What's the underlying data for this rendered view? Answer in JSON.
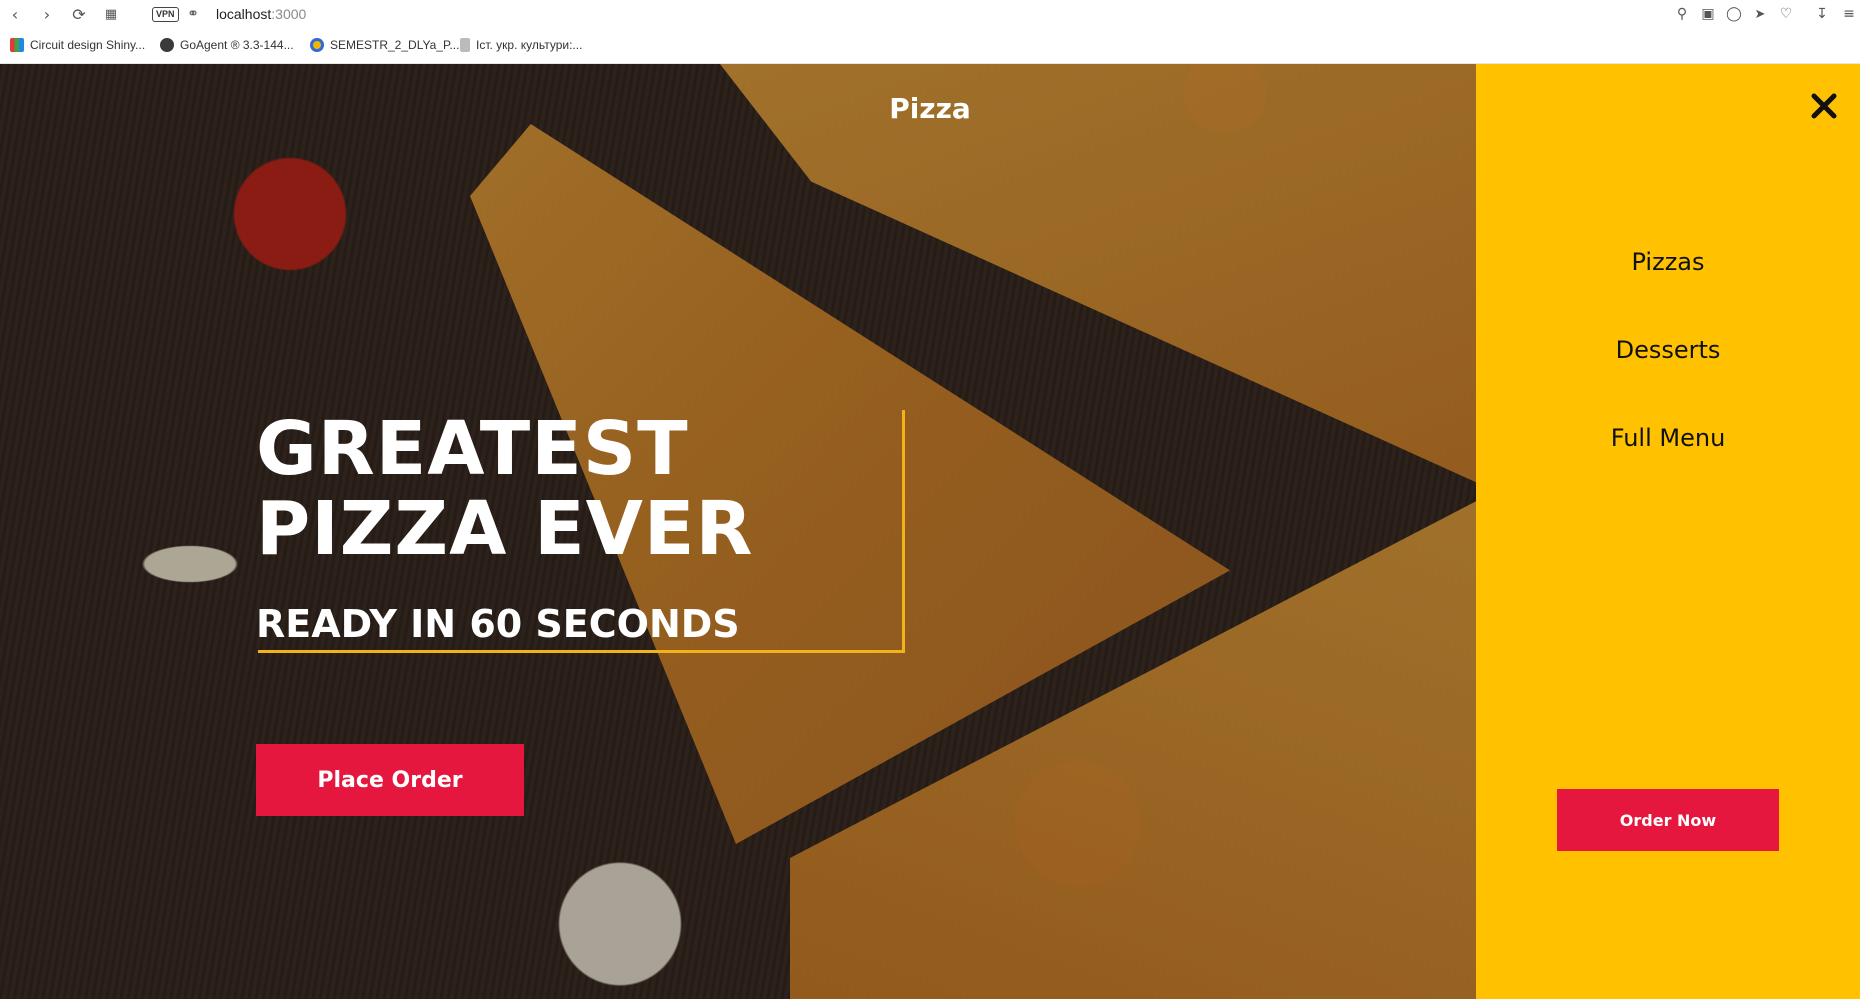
{
  "browser": {
    "url_host": "localhost",
    "url_port": ":3000",
    "vpn_label": "VPN",
    "bookmarks": [
      {
        "label": "Circuit design Shiny..."
      },
      {
        "label": "GoAgent ® 3.3-144..."
      },
      {
        "label": "SEMESTR_2_DLYa_P..."
      },
      {
        "label": "Іст. укр. культури:..."
      }
    ]
  },
  "hero": {
    "brand": "Pizza",
    "headline_line1": "GREATEST",
    "headline_line2": "PIZZA EVER",
    "subline": "READY IN 60 SECONDS",
    "cta_label": "Place Order"
  },
  "side_menu": {
    "items": [
      {
        "label": "Pizzas"
      },
      {
        "label": "Desserts"
      },
      {
        "label": "Full Menu"
      }
    ],
    "order_label": "Order Now"
  },
  "colors": {
    "accent_yellow": "#ffc100",
    "cta_red": "#e5173f",
    "frame_yellow": "#f2b31a"
  }
}
